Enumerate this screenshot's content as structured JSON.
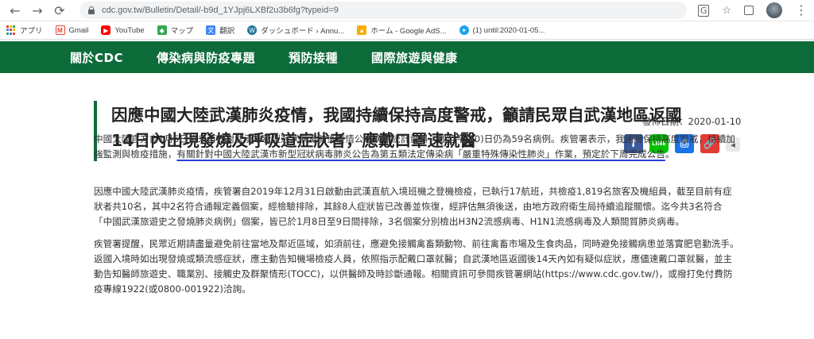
{
  "browser": {
    "url": "cdc.gov.tw/Bulletin/Detail/-b9d_1YJpj6LXBf2u3b6fg?typeid=9",
    "back": "←",
    "forward": "→",
    "reload": "⟳",
    "star": "☆",
    "more": "⋮"
  },
  "bookmarks": [
    {
      "label": "アプリ"
    },
    {
      "label": "Gmail"
    },
    {
      "label": "YouTube"
    },
    {
      "label": "マップ"
    },
    {
      "label": "翻訳"
    },
    {
      "label": "ダッシュボード › Annu..."
    },
    {
      "label": "ホーム - Google AdS..."
    },
    {
      "label": "(1) until:2020-01-05..."
    }
  ],
  "sitenav": {
    "items": [
      "關於CDC",
      "傳染病與防疫專題",
      "預防接種",
      "國際旅遊與健康"
    ]
  },
  "article": {
    "title_line1": "因應中國大陸武漢肺炎疫情，我國持續保持高度警戒，籲請民眾自武漢地區返國",
    "title_line2": "14日內出現發燒及呼吸道症狀者，應戴口罩速就醫",
    "date": "發佈日期：2020-01-10",
    "p1_a": "中國大陸官方自1月5日後未再針對武漢市新型冠狀病毒肺炎疫情公布病例統計資料，截至今(10)日仍為59名病例。疾管署表示，我國將保持高度警戒，持續加強監測與檢疫措施，",
    "p1_b": "有關針對中國大陸武漢市新型冠狀病毒肺炎公告為第五類法定傳染病「嚴重特殊傳染性肺炎」作業，預定於下周完成公告",
    "p1_c": "。",
    "p2": "因應中國大陸武漢肺炎疫情，疾管署自2019年12月31日啟動由武漢直航入境班機之登機檢疫，已執行17航班，共檢疫1,819名旅客及機組員，截至目前有症狀者共10名，其中2名符合通報定義個案，經檢驗排除，其餘8人症狀皆已改善並恢復，經評估無須後送，由地方政府衛生局持續追蹤關懷。迄今共3名符合「中國武漢旅遊史之發燒肺炎病例」個案，皆已於1月8日至9日間排除，3名個案分別檢出H3N2流感病毒、H1N1流感病毒及人類間質肺炎病毒。",
    "p3": "疾管署提醒，民眾近期請盡量避免前往當地及鄰近區域，如須前往，應避免接觸禽畜類動物、前往禽畜市場及生食肉品，同時避免接觸病患並落實肥皂勤洗手。返國入境時如出現發燒或類流感症狀，應主動告知機場檢疫人員，依照指示配戴口罩就醫；自武漢地區返國後14天內如有疑似症狀，應儘速戴口罩就醫，並主動告知醫師旅遊史、職業別、接觸史及群聚情形(TOCC)，以供醫師及時診斷通報。相關資訊可參閱疾管署網站(https://www.cdc.gov.tw/)，或撥打免付費防疫專線1922(或0800-001922)洽詢。"
  },
  "share": {
    "facebook": "f",
    "line": "LINE",
    "print": "⎙",
    "link": "🔗",
    "back": "◂"
  },
  "colors": {
    "site_green": "#0d6b3a",
    "underline_blue": "#2b3fd9"
  }
}
